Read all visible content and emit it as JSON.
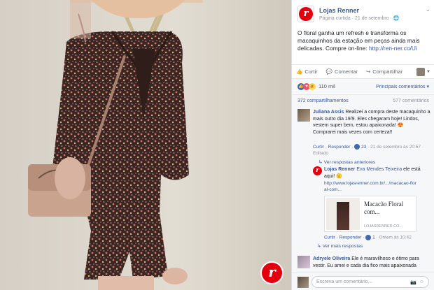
{
  "post": {
    "page_name": "Lojas Renner",
    "meta": "Página curtida · 21 de setembro · ",
    "text": "O floral ganha um refresh e transforma os macaquinhos da estação em peças ainda mais delicadas. Compre on-line: ",
    "link": "http://ren-ner.co/Ui",
    "brand_letter": "r"
  },
  "actions": {
    "like": "Curtir",
    "comment": "Comentar",
    "share": "Compartilhar"
  },
  "stats": {
    "reactions": "110 mil",
    "sort": "Principais comentários ▾",
    "shares": "372 compartilhamentos",
    "comments": "577 comentários"
  },
  "comments": [
    {
      "author": "Juliana Assis",
      "text": "Realizei a compra deste macaquinho a mais outro dia 19/9. Eles chegaram hoje! Lindos, vestem super bem, estou apaixonada!",
      "text2": "Comprarei mais vezes com certeza!!",
      "actions": "Curtir · Responder · ",
      "count": "23",
      "time": " · 21 de setembro às 20:57 · Editado",
      "view_previous": "Ver respostas anteriores"
    },
    {
      "author": "Lojas Renner",
      "mention": "Eva Mendes Teixeira",
      "text": " ele está aqui!",
      "link": "http://www.lojasrenner.com.br/.../macacao-floral-com...",
      "card_title": "Macacão Floral com...",
      "card_domain": "LOJASRENNER.CO...",
      "actions": "Curtir · Responder · ",
      "count": "1",
      "time": " · Ontem às 10:42",
      "view_more": "Ver mais respostas"
    },
    {
      "author": "Adryele Oliveira",
      "text": "Ele é maravilhoso e ótimo para vestir. Eu amei e cada dia fico mais apaixonada"
    }
  ],
  "composer": {
    "placeholder": "Escreva um comentário..."
  },
  "colors": {
    "brand_red": "#e3000f",
    "link": "#365899",
    "like_blue": "#4267b2"
  }
}
